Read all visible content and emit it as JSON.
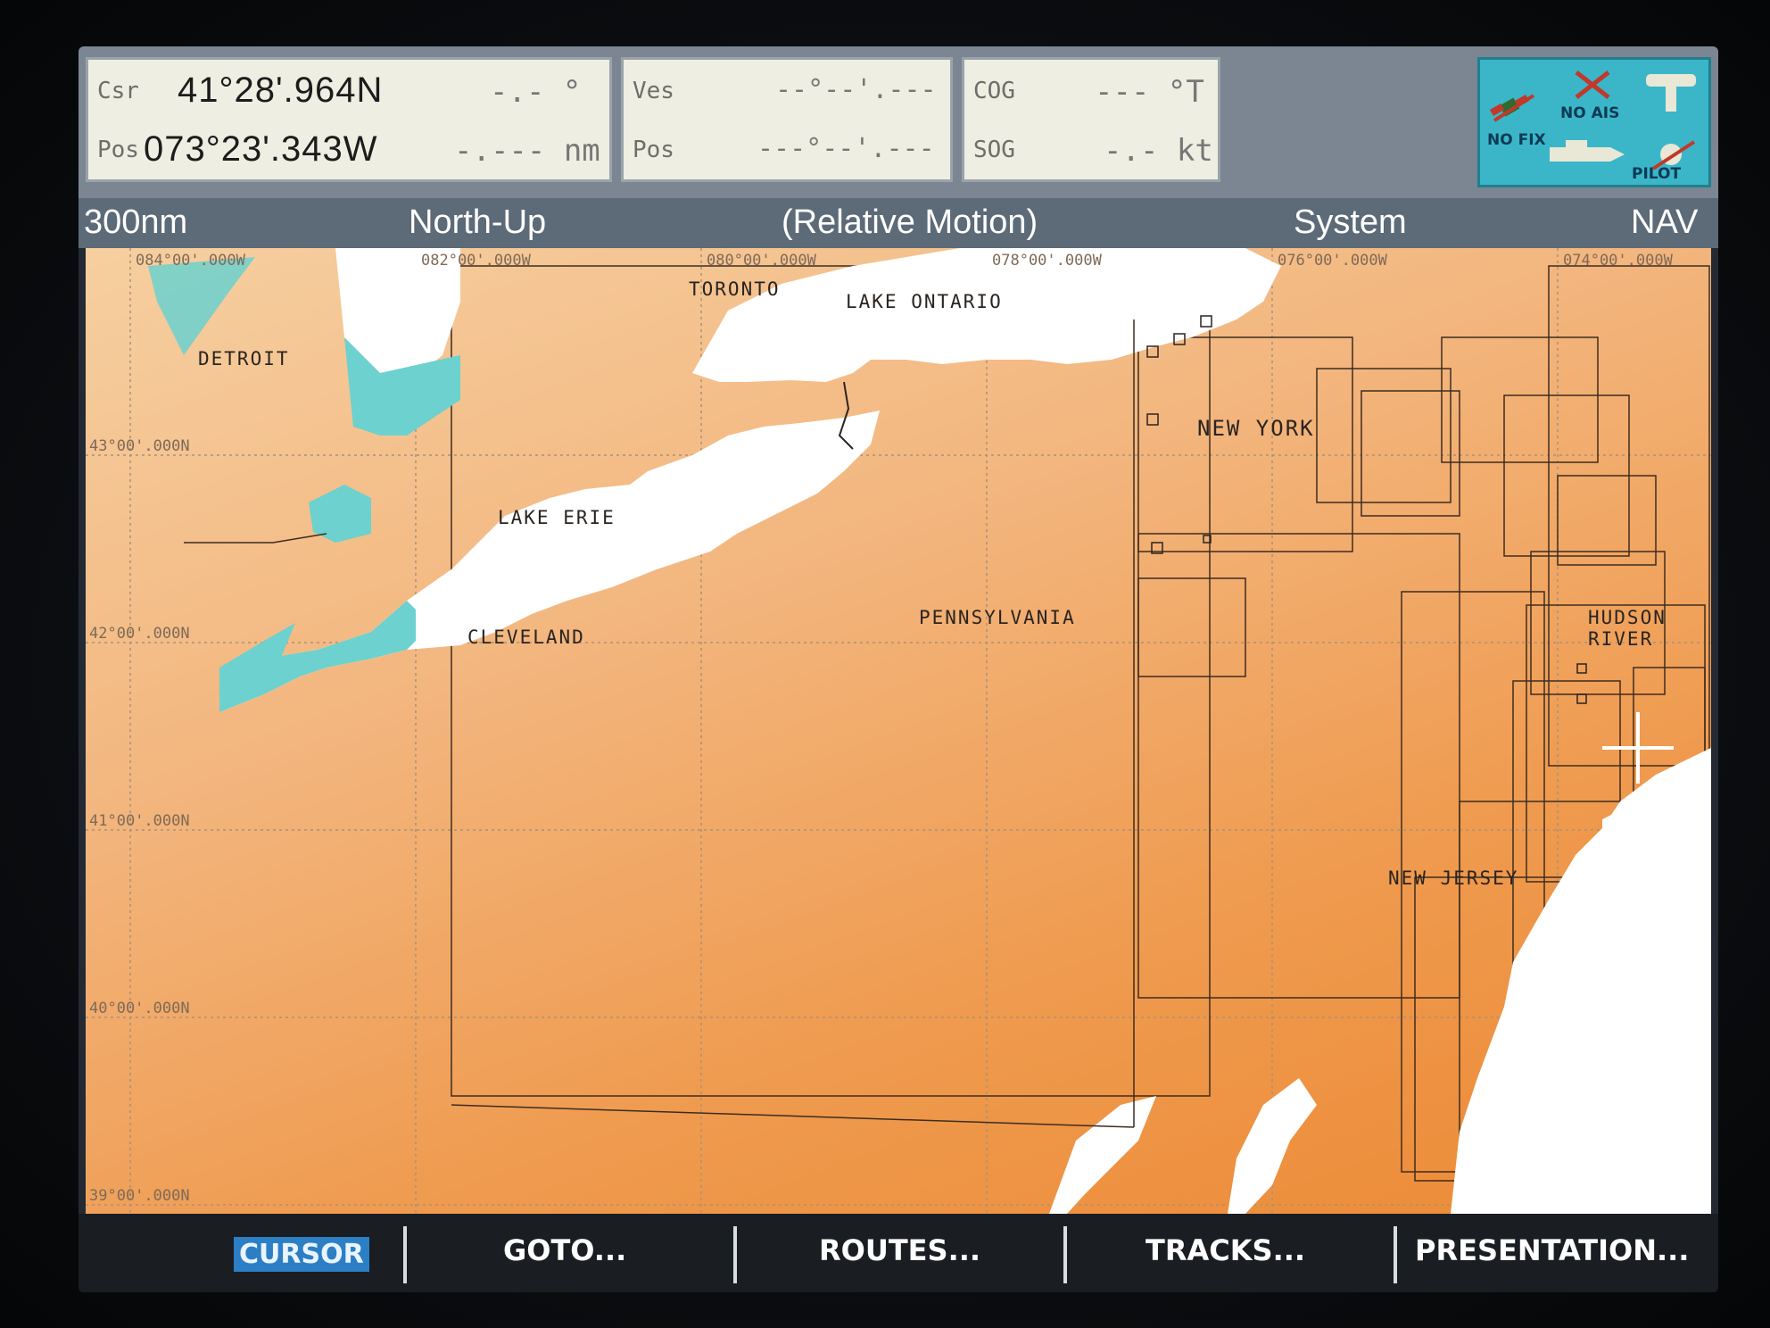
{
  "databar": {
    "csr_label": "Csr",
    "csr_lat": "41°28'.964N",
    "csr_bearing": "-.- °",
    "pos_label": "Pos",
    "csr_lon": "073°23'.343W",
    "csr_range": "-.--- nm",
    "ves_label": "Ves",
    "ves_lat": "--°--'.---",
    "ves_pos_label": "Pos",
    "ves_lon": "---°--'.---",
    "cog_label": "COG",
    "cog_value": "--- °T",
    "sog_label": "SOG",
    "sog_value": "-.- kt"
  },
  "status": {
    "no_fix": "NO FIX",
    "no_ais": "NO AIS",
    "pilot": "PILOT"
  },
  "header": {
    "range": "300nm",
    "orientation": "North-Up",
    "motion": "(Relative Motion)",
    "mode": "System",
    "page": "NAV"
  },
  "map": {
    "lon_labels": [
      "084°00'.000W",
      "082°00'.000W",
      "080°00'.000W",
      "078°00'.000W",
      "076°00'.000W",
      "074°00'.000W"
    ],
    "lat_labels": [
      "43°00'.000N",
      "42°00'.000N",
      "41°00'.000N",
      "40°00'.000N",
      "39°00'.000N"
    ],
    "place_labels": {
      "toronto": "TORONTO",
      "lake_ontario": "LAKE ONTARIO",
      "detroit": "DETROIT",
      "new_york": "NEW YORK",
      "lake_erie": "LAKE ERIE",
      "hudson_river": "HUDSON RIVER",
      "pennsylvania": "PENNSYLVANIA",
      "cleveland": "CLEVELAND",
      "new_jersey": "NEW JERSEY"
    }
  },
  "softkeys": {
    "cursor": "CURSOR",
    "goto": "GOTO...",
    "routes": "ROUTES...",
    "tracks": "TRACKS...",
    "presentation": "PRESENTATION..."
  },
  "colors": {
    "land_gradient_start": "#f6cfa0",
    "land_gradient_end": "#ec8a35",
    "water": "#ffffff",
    "shallow_water": "#6cd1cf",
    "status_box": "#3bb6c8",
    "softkey_highlight": "#2c7fc4"
  }
}
